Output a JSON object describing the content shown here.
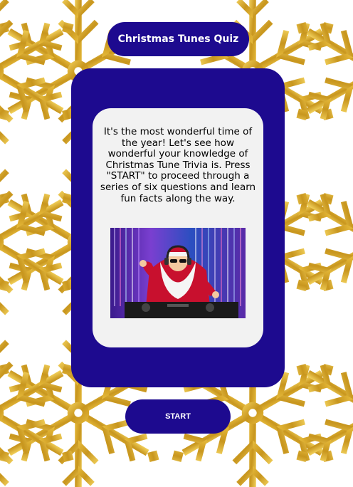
{
  "header": {
    "title": "Christmas Tunes Quiz"
  },
  "card": {
    "intro_text": "It's the most wonderful time of the year! Let's see how wonderful your knowledge of Christmas Tune Trivia is. Press \"START\" to proceed through a series of six questions and learn fun facts along the way.",
    "image_alt": "Santa Claus DJ with headphones at turntables"
  },
  "actions": {
    "start_label": "START"
  },
  "colors": {
    "accent": "#1d0a8f",
    "panel": "#f2f2f2",
    "snowflake": "#d4a020"
  },
  "icons": {
    "background": "snowflake-icon"
  }
}
